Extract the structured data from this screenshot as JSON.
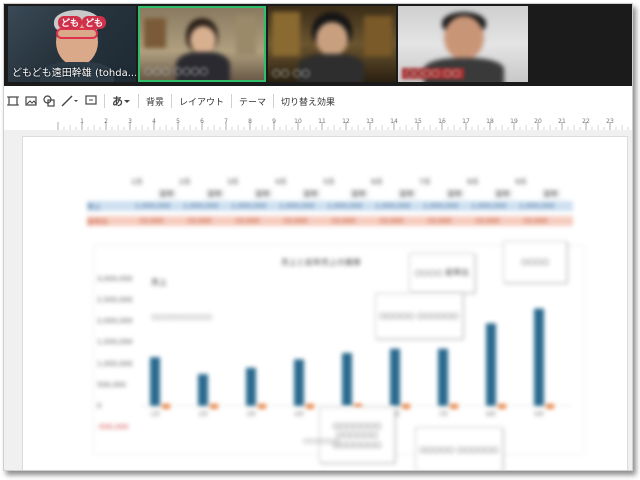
{
  "participants": [
    {
      "name": "どもども遠田幹雄 (tohda...",
      "badge": "ども",
      "badge2": "ども"
    },
    {
      "name": "○○○ ○○○○"
    },
    {
      "name": "○○ ○○"
    },
    {
      "name": "○○○○ ○○"
    }
  ],
  "toolbar": {
    "text_style": "あ",
    "background_label": "背景",
    "layout_label": "レイアウト",
    "theme_label": "テーマ",
    "transition_label": "切り替え効果"
  },
  "ruler": {
    "numbers": [
      "1",
      "2",
      "3",
      "4",
      "5",
      "6",
      "7",
      "8",
      "9",
      "10",
      "11",
      "12",
      "13",
      "14",
      "15",
      "16",
      "17",
      "18",
      "19",
      "20",
      "21",
      "22",
      "23",
      "24",
      "25"
    ]
  },
  "slide": {
    "header_row1": [
      "1月",
      "2月",
      "3月",
      "4月",
      "5月",
      "6月",
      "7月",
      "8月",
      "9月"
    ],
    "header_row2": [
      "前年",
      "前年",
      "前年",
      "前年",
      "前年",
      "前年",
      "前年",
      "前年",
      "前年"
    ],
    "row_blue_label": "売上",
    "row_pink_label": "前年比",
    "row_blue_values": [
      "1,000,000",
      "1,000,000",
      "1,000,000",
      "1,000,000",
      "1,000,000",
      "1,000,000",
      "1,000,000",
      "1,000,000",
      "1,000,000"
    ],
    "row_pink_values": [
      "10,000",
      "10,000",
      "10,000",
      "10,000",
      "10,000",
      "10,000",
      "10,000",
      "10,000",
      "10,000"
    ],
    "chart_title": "売上と前年売上の推移",
    "chart_note": "売上",
    "chart_note2": "○○○○○○○○○○",
    "y_ticks": [
      "3,000,000",
      "2,500,000",
      "2,000,000",
      "1,500,000",
      "1,000,000",
      "500,000",
      "0",
      "-500,000"
    ],
    "callouts": [
      {
        "text": "○○○○"
      },
      {
        "text": "○○○○ 前年比"
      },
      {
        "text": "○○○○○ ○○○○○○"
      },
      {
        "text": "○○○○○○○ ○○○○○○ ○○○○○○○"
      },
      {
        "text": "○○○○○ ○○○○○○"
      }
    ],
    "legend": "○○○○○○"
  },
  "chart_data": {
    "type": "bar",
    "categories": [
      "1月",
      "2月",
      "3月",
      "4月",
      "5月",
      "6月",
      "7月",
      "8月",
      "9月"
    ],
    "series": [
      {
        "values": [
          1150000,
          750000,
          900000,
          1100000,
          1250000,
          1350000,
          1350000,
          1950000,
          2300000
        ]
      }
    ],
    "ylim": [
      -500000,
      3000000
    ]
  }
}
